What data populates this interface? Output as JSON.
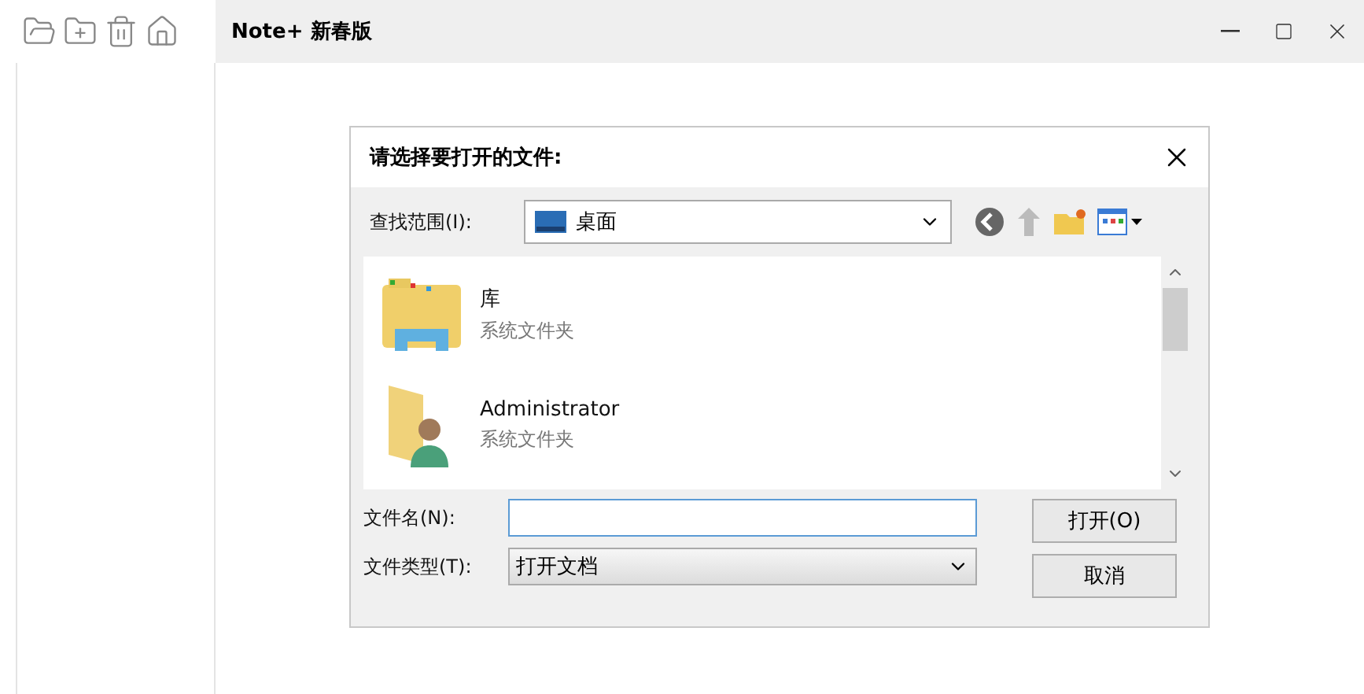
{
  "window": {
    "title": "Note+ 新春版"
  },
  "dialog": {
    "title": "请选择要打开的文件:",
    "look_in_label": "查找范围(I):",
    "location": "桌面",
    "items": [
      {
        "kind": "library",
        "name": "库",
        "type": "系统文件夹"
      },
      {
        "kind": "user",
        "name": "Administrator",
        "type": "系统文件夹"
      }
    ],
    "filename_label": "文件名(N):",
    "filetype_label": "文件类型(T):",
    "filetype": "打开文档",
    "buttons": [
      "打开(O)",
      "取消"
    ]
  }
}
